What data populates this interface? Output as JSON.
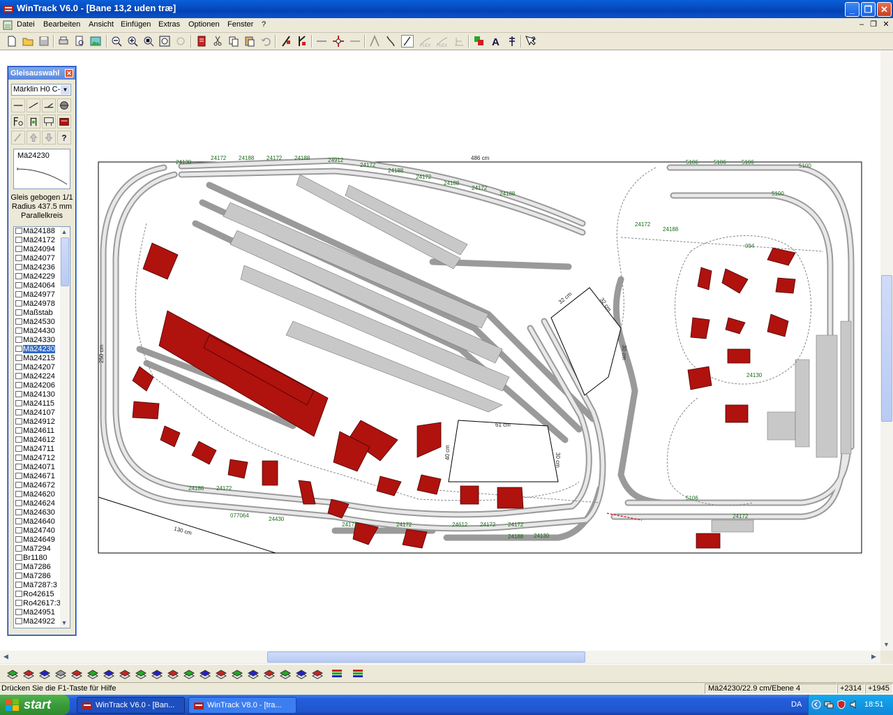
{
  "window": {
    "title": "WinTrack  V6.0 - [Bane 13,2 uden træ]",
    "app_icon": "wintrack-app-icon"
  },
  "menu": {
    "items": [
      "Datei",
      "Bearbeiten",
      "Ansicht",
      "Einfügen",
      "Extras",
      "Optionen",
      "Fenster",
      "?"
    ]
  },
  "panel": {
    "title": "Gleisauswahl",
    "library": "Märklin H0 C-",
    "preview_label": "Mä24230",
    "description_line1": "Gleis gebogen 1/1",
    "description_line2": "Radius 437.5 mm",
    "description_line3": "Parallelkreis",
    "selected_item": "Mä24230",
    "items": [
      "Mä24188",
      "Mä24172",
      "Mä24094",
      "Mä24077",
      "Mä24236",
      "Mä24229",
      "Mä24064",
      "Mä24977",
      "Mä24978",
      "Maßstab",
      "Mä24530",
      "Mä24430",
      "Mä24330",
      "Mä24230",
      "Mä24215",
      "Mä24207",
      "Mä24224",
      "Mä24206",
      "Mä24130",
      "Mä24115",
      "Mä24107",
      "Mä24912",
      "Mä24611",
      "Mä24612",
      "Mä24711",
      "Mä24712",
      "Mä24071",
      "Mä24671",
      "Mä24672",
      "Mä24620",
      "Mä24624",
      "Mä24630",
      "Mä24640",
      "Mä24740",
      "Mä24649",
      "Mä7294",
      "Br1180",
      "Mä7286",
      "Mä7286",
      "Mä7287:3",
      "Ro42615",
      "Ro42617:3",
      "Mä24951",
      "Mä24922"
    ]
  },
  "layout": {
    "width_label": "486 cm",
    "height_label": "250 cm",
    "dimension_labels": [
      "32 cm",
      "32 cm",
      "30 cm",
      "61 cm",
      "40 cm",
      "30 cm",
      "130 cm"
    ],
    "track_labels_top": [
      "24130",
      "24172",
      "24188",
      "24172",
      "24188",
      "24912",
      "24172",
      "24188",
      "24172",
      "24188",
      "24172",
      "24188"
    ],
    "track_labels_bottom": [
      "24188",
      "24172",
      "077064",
      "24430",
      "24172",
      "24172",
      "24612",
      "24172",
      "24172",
      "24188",
      "24130"
    ],
    "track_labels_right": [
      "5106",
      "5106",
      "5106",
      "5106",
      "5100",
      "5100",
      "24172",
      "24188",
      "094",
      "24130",
      "24172"
    ]
  },
  "status": {
    "help": "Drücken Sie die  F1-Taste für Hilfe",
    "selection": "Mä24230/22.9 cm/Ebene 4",
    "x": "+2314",
    "y": "+1945"
  },
  "taskbar": {
    "start": "start",
    "tasks": [
      "WinTrack  V6.0 - [Ban...",
      "WinTrack  V8.0 - [tra..."
    ],
    "lang": "DA",
    "clock": "18:51"
  },
  "colors": {
    "house_red": "#b0120e",
    "track_gray": "#c8c8c8",
    "label_green": "#1a6b1a",
    "selection_blue": "#316ac5"
  }
}
